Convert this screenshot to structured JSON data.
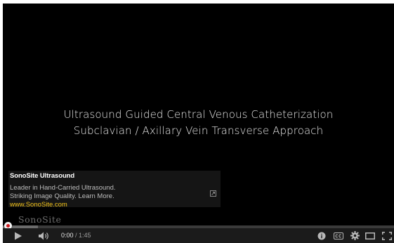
{
  "video": {
    "title_line_1": "Ultrasound Guided Central Venous Catheterization",
    "title_line_2": "Subclavian / Axillary Vein Transverse Approach"
  },
  "ad": {
    "sponsor": "SonoSite Ultrasound",
    "line_1": "Leader in Hand-Carried Ultrasound.",
    "line_2": "Striking Image Quality. Learn More.",
    "url": "www.SonoSite.com",
    "icon": "external-link-icon"
  },
  "watermark": {
    "text": "SonoSite"
  },
  "progress": {
    "played_fraction": 0.0,
    "loaded_fraction": 0.09
  },
  "controls": {
    "current_time": "0:00",
    "separator": " / ",
    "duration": "1:45",
    "icons": [
      "play-icon",
      "volume-icon",
      "info-icon",
      "captions-icon",
      "settings-icon",
      "theater-mode-icon",
      "fullscreen-icon"
    ]
  },
  "colors": {
    "accent": "#cc181e",
    "ad_url": "#f3c318",
    "background": "#000000"
  }
}
